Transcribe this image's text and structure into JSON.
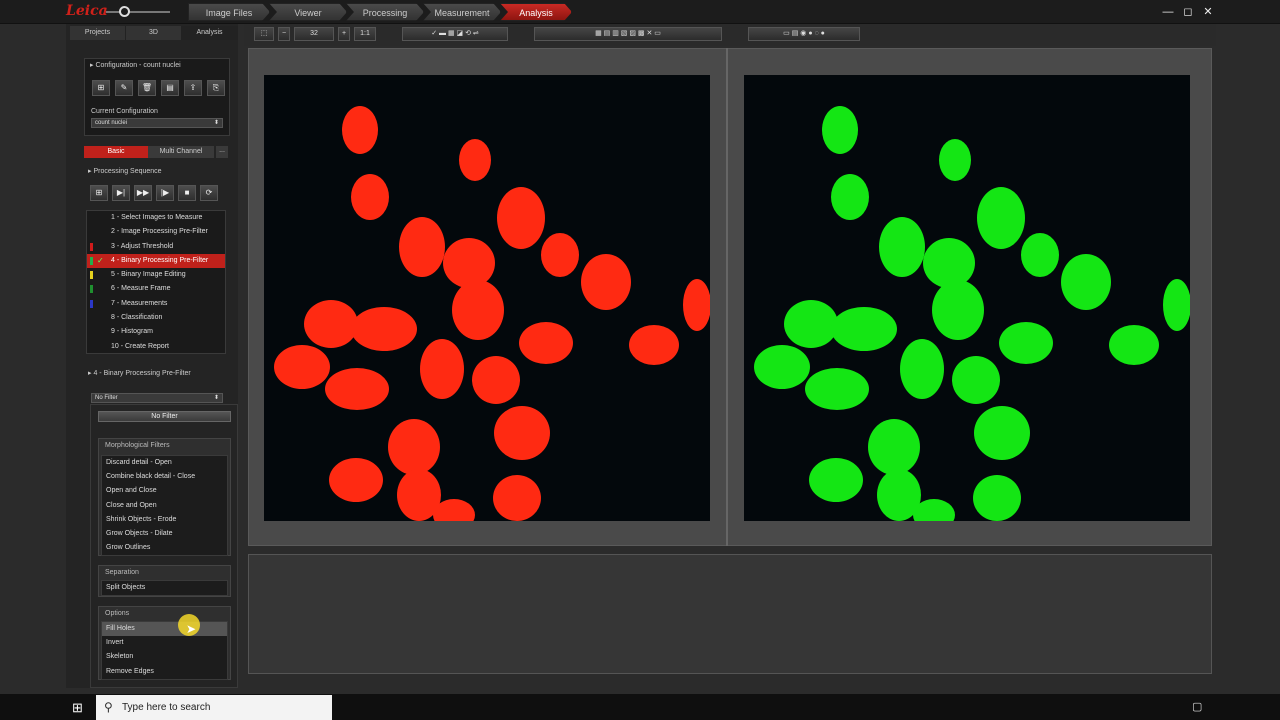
{
  "window": {
    "logo": "Leica",
    "controls": [
      "—",
      "◻",
      "✕"
    ]
  },
  "workflow": {
    "steps": [
      "Image Files",
      "Viewer",
      "Processing",
      "Measurement",
      "Analysis"
    ],
    "active": "Analysis"
  },
  "left_tabs": [
    "Projects",
    "3D",
    "Analysis"
  ],
  "configuration": {
    "header": "Configuration - count nuclei",
    "current_label": "Current Configuration",
    "current_value": "count nuclei"
  },
  "mode_tabs": [
    "Basic",
    "Multi Channel",
    "..."
  ],
  "processing_sequence": {
    "header": "Processing Sequence",
    "steps": [
      {
        "label": "1 - Select Images to Measure",
        "color": ""
      },
      {
        "label": "2 - Image Processing Pre-Filter",
        "color": ""
      },
      {
        "label": "3 - Adjust Threshold",
        "color": "#d01b1b"
      },
      {
        "label": "4 - Binary Processing Pre-Filter",
        "color": "#22b14c"
      },
      {
        "label": "5 - Binary Image Editing",
        "color": "#e6d21e"
      },
      {
        "label": "6 - Measure Frame",
        "color": "#1f8f2f"
      },
      {
        "label": "7 - Measurements",
        "color": "#2b38c8"
      },
      {
        "label": "8 - Classification",
        "color": ""
      },
      {
        "label": "9 - Histogram",
        "color": ""
      },
      {
        "label": "10 - Create Report",
        "color": ""
      }
    ],
    "active_index": 3
  },
  "binary_prefilter": {
    "header": "4 - Binary Processing Pre-Filter",
    "dropdown_value": "No Filter",
    "no_filter": "No Filter",
    "morph_title": "Morphological Filters",
    "morph_items": [
      "Discard detail - Open",
      "Combine black detail - Close",
      "Open and Close",
      "Close and Open",
      "Shrink Objects - Erode",
      "Grow Objects - Dilate",
      "Grow Outlines"
    ],
    "separation_title": "Separation",
    "separation_items": [
      "Split Objects"
    ],
    "options_title": "Options",
    "options_items": [
      "Fill Holes",
      "Invert",
      "Skeleton",
      "Remove Edges"
    ],
    "hover_item": "Fill Holes"
  },
  "toolbar": {
    "zoom_value": "32"
  },
  "taskbar": {
    "search_placeholder": "Type here to search"
  },
  "colors": {
    "accent": "#c0211b",
    "nuclei_left": "#ff2a12",
    "nuclei_right": "#14e614"
  }
}
